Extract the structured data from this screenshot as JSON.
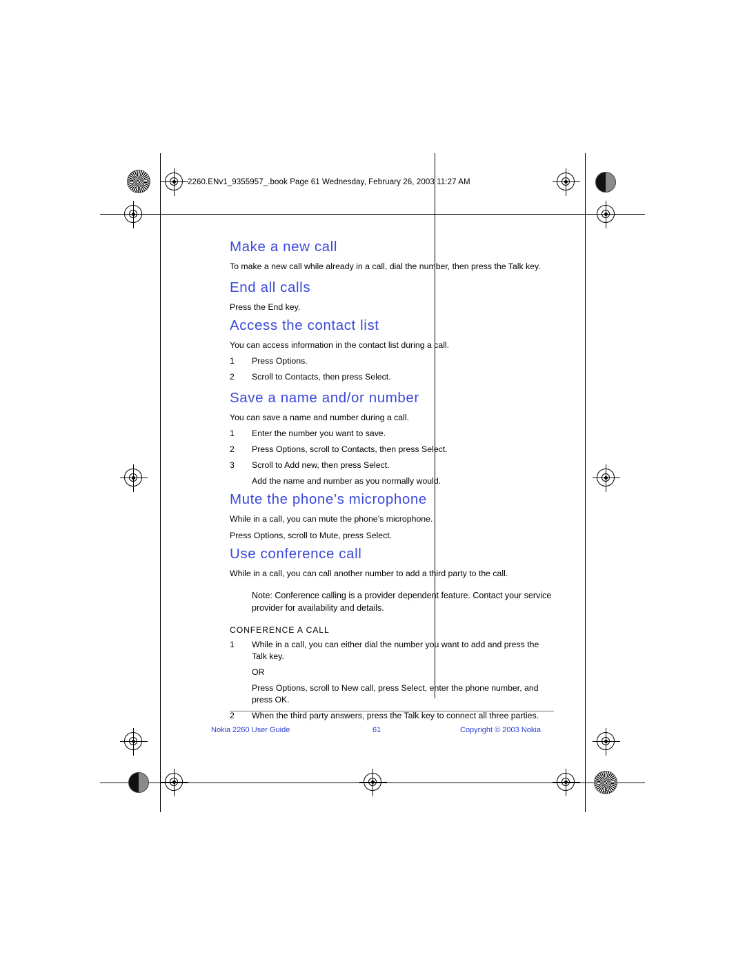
{
  "print_header": "2260.ENv1_9355957_.book  Page 61  Wednesday, February 26, 2003  11:27 AM",
  "sections": [
    {
      "heading": "Make a new call",
      "paragraphs": [
        "To make a new call while already in a call, dial the number, then press the Talk key."
      ],
      "steps": []
    },
    {
      "heading": "End all calls",
      "paragraphs": [
        "Press the End key."
      ],
      "steps": []
    },
    {
      "heading": "Access the contact list",
      "paragraphs": [
        "You can access information in the contact list during a call."
      ],
      "steps": [
        {
          "num": "1",
          "text": "Press Options."
        },
        {
          "num": "2",
          "text": "Scroll to Contacts, then press Select."
        }
      ]
    },
    {
      "heading": "Save a name and/or number",
      "paragraphs": [
        "You can save a name and number during a call."
      ],
      "steps": [
        {
          "num": "1",
          "text": "Enter the number you want to save."
        },
        {
          "num": "2",
          "text": "Press Options, scroll to Contacts, then press Select."
        },
        {
          "num": "3",
          "text": "Scroll to Add new, then press Select."
        }
      ],
      "trailing": "Add the name and number as you normally would."
    },
    {
      "heading": "Mute the phone’s microphone",
      "paragraphs": [
        "While in a call, you can mute the phone’s microphone.",
        "Press Options, scroll to Mute, press Select."
      ],
      "steps": []
    },
    {
      "heading": "Use conference call",
      "paragraphs": [
        "While in a call, you can call another number to add a third party to the call."
      ],
      "steps": []
    }
  ],
  "note": "Note: Conference calling is a provider dependent feature. Contact your service provider for availability and details.",
  "subheading": "CONFERENCE A CALL",
  "conference_steps": [
    {
      "num": "1",
      "text": "While in a call, you can either dial the number you want to add and press the Talk key."
    },
    {
      "num": "",
      "text": "OR"
    },
    {
      "num": "",
      "text": "Press Options, scroll to New call, press Select, enter the phone number, and press OK."
    },
    {
      "num": "2",
      "text": "When the third party answers, press the Talk key to connect all three parties."
    }
  ],
  "footer": {
    "left": "Nokia 2260 User Guide",
    "center": "61",
    "right": "Copyright © 2003 Nokia"
  },
  "colors": {
    "heading": "#3b49d8",
    "footer": "#2b3fd0",
    "text": "#000000"
  }
}
